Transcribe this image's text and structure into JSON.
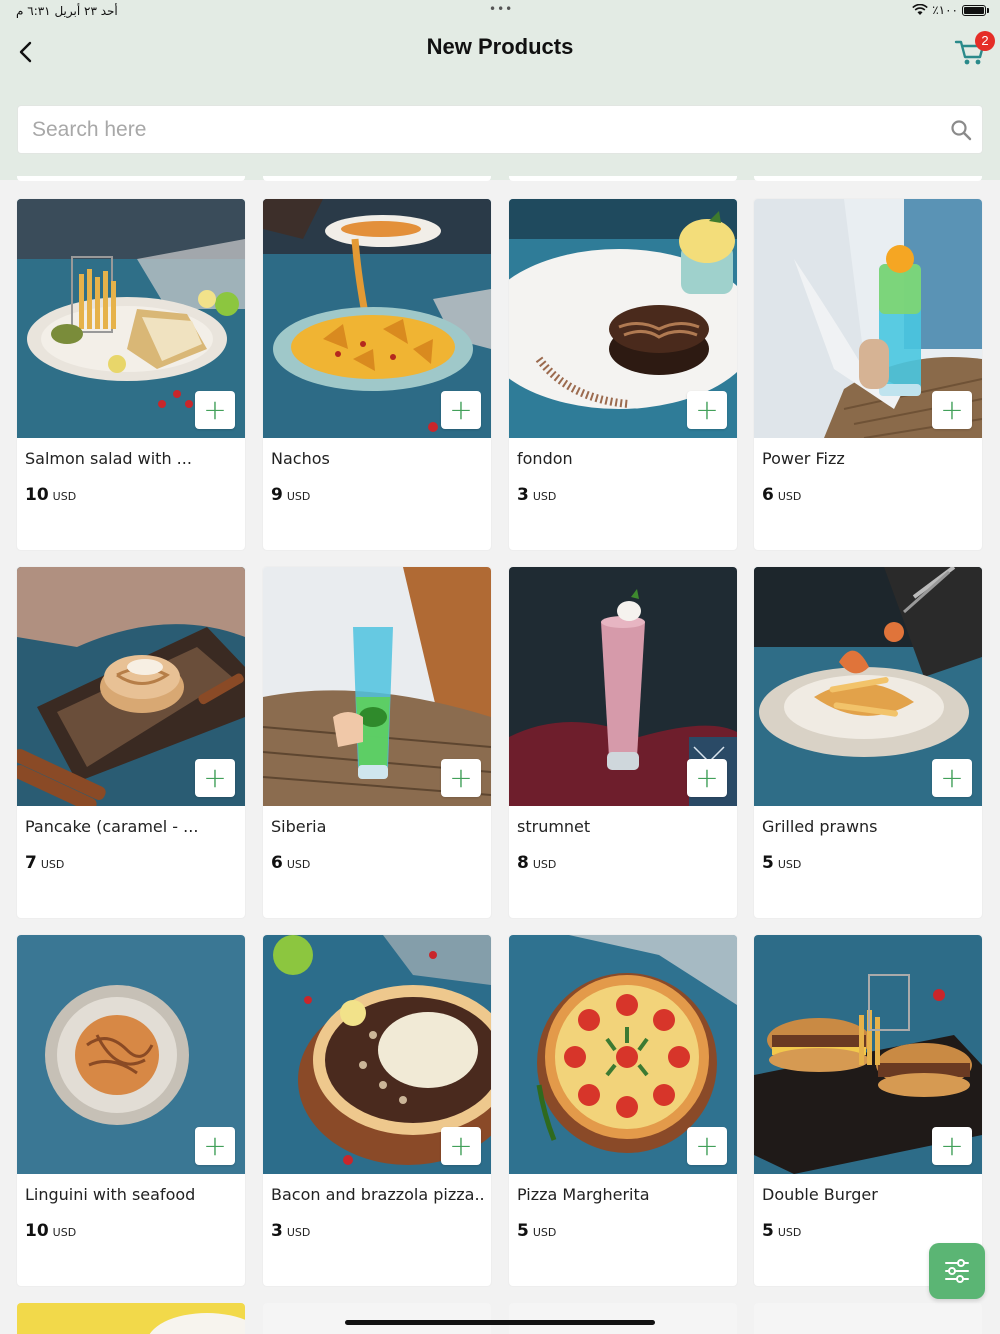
{
  "status_bar": {
    "left_text": "أحد ٢٣ أبريل ٦:٣١ م",
    "dots": "•••",
    "battery_text": "٪١٠٠"
  },
  "header": {
    "title": "New Products",
    "cart_count": "2"
  },
  "search": {
    "placeholder": "Search here"
  },
  "colors": {
    "accent": "#5bb574",
    "plus": "#42a05a",
    "header_bg": "#e3ebe4",
    "badge": "#e52d27"
  },
  "products": [
    {
      "name": "Salmon salad with ...",
      "price": "10",
      "currency": "USD",
      "image": "sandwich-fries-plate"
    },
    {
      "name": "Nachos",
      "price": "9",
      "currency": "USD",
      "image": "nachos-plate"
    },
    {
      "name": "fondon",
      "price": "3",
      "currency": "USD",
      "image": "chocolate-fondant-plate"
    },
    {
      "name": "Power Fizz",
      "price": "6",
      "currency": "USD",
      "image": "blue-drink-glass"
    },
    {
      "name": "Pancake (caramel - ...",
      "price": "7",
      "currency": "USD",
      "image": "cinnamon-roll-board"
    },
    {
      "name": "Siberia",
      "price": "6",
      "currency": "USD",
      "image": "blue-green-drink-glass"
    },
    {
      "name": "strumnet",
      "price": "8",
      "currency": "USD",
      "image": "pink-milkshake-glass"
    },
    {
      "name": "Grilled prawns",
      "price": "5",
      "currency": "USD",
      "image": "prawn-pasta-bowl"
    },
    {
      "name": "Linguini with seafood",
      "price": "10",
      "currency": "USD",
      "image": "seafood-pasta-bowl"
    },
    {
      "name": "Bacon and brazzola pizza...",
      "price": "3",
      "currency": "USD",
      "image": "brazzola-pizza"
    },
    {
      "name": "Pizza Margherita",
      "price": "5",
      "currency": "USD",
      "image": "margherita-pizza"
    },
    {
      "name": "Double Burger",
      "price": "5",
      "currency": "USD",
      "image": "burgers-fries-board"
    }
  ]
}
